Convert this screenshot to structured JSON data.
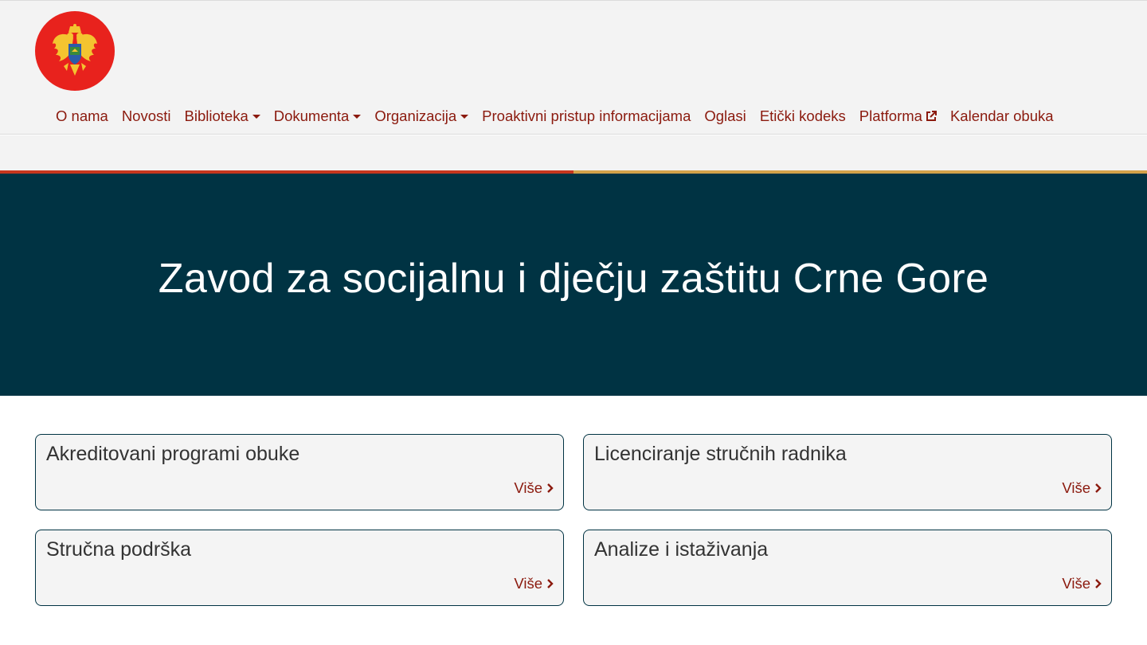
{
  "header": {
    "logo_name": "montenegro-coat-of-arms",
    "nav": [
      {
        "label": "O nama",
        "dropdown": false,
        "external": false
      },
      {
        "label": "Novosti",
        "dropdown": false,
        "external": false
      },
      {
        "label": "Biblioteka",
        "dropdown": true,
        "external": false
      },
      {
        "label": "Dokumenta",
        "dropdown": true,
        "external": false
      },
      {
        "label": "Organizacija",
        "dropdown": true,
        "external": false
      },
      {
        "label": "Proaktivni pristup informacijama",
        "dropdown": false,
        "external": false
      },
      {
        "label": "Oglasi",
        "dropdown": false,
        "external": false
      },
      {
        "label": "Etički kodeks",
        "dropdown": false,
        "external": false
      },
      {
        "label": "Platforma",
        "dropdown": false,
        "external": true
      },
      {
        "label": "Kalendar obuka",
        "dropdown": false,
        "external": false
      }
    ]
  },
  "hero": {
    "title": "Zavod za socijalnu i dječju zaštitu Crne Gore"
  },
  "cards": [
    {
      "title": "Akreditovani programi obuke",
      "more": "Više"
    },
    {
      "title": "Licenciranje stručnih radnika",
      "more": "Više"
    },
    {
      "title": "Stručna podrška",
      "more": "Više"
    },
    {
      "title": "Analize i istaživanja",
      "more": "Više"
    }
  ],
  "colors": {
    "accent": "#8b1a0e",
    "hero_bg": "#003343",
    "stripe_red": "#c6371e",
    "stripe_gold": "#d3a24a",
    "logo_red": "#e8221d"
  }
}
